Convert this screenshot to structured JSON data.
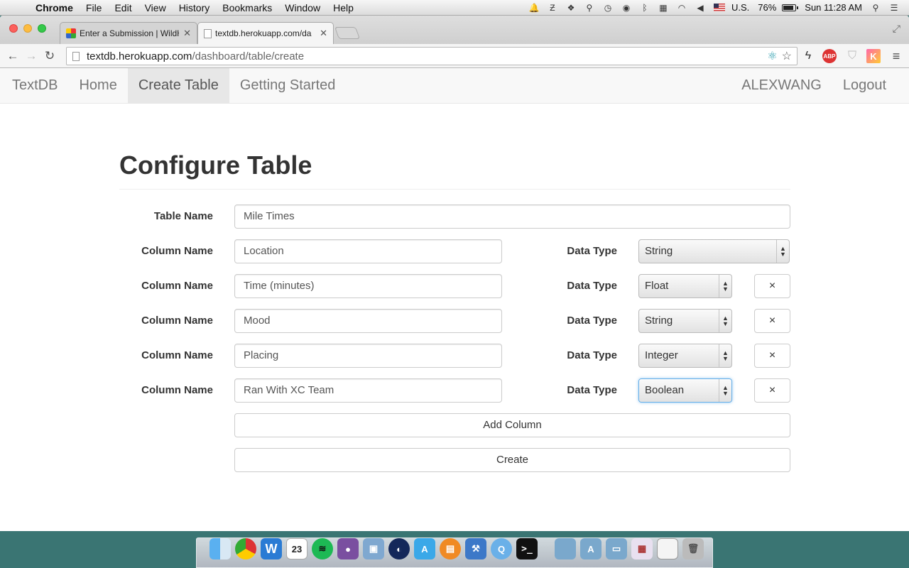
{
  "menubar": {
    "app_name": "Chrome",
    "menus": [
      "File",
      "Edit",
      "View",
      "History",
      "Bookmarks",
      "Window",
      "Help"
    ],
    "input_source": "U.S.",
    "battery": "76%",
    "clock": "Sun 11:28 AM"
  },
  "browser": {
    "tabs": [
      {
        "title": "Enter a Submission | WildH"
      },
      {
        "title": "textdb.herokuapp.com/da"
      }
    ],
    "url_host": "textdb.herokuapp.com",
    "url_path": "/dashboard/table/create",
    "extensions": {
      "abp": "ABP",
      "kred": "K"
    }
  },
  "navbar": {
    "brand": "TextDB",
    "links": [
      "Home",
      "Create Table",
      "Getting Started"
    ],
    "active": "Create Table",
    "user": "ALEXWANG",
    "logout": "Logout"
  },
  "form": {
    "heading": "Configure Table",
    "table_name_label": "Table Name",
    "table_name_value": "Mile Times",
    "column_label": "Column Name",
    "data_type_label": "Data Type",
    "columns": [
      {
        "name": "Location",
        "type": "String"
      },
      {
        "name": "Time (minutes)",
        "type": "Float"
      },
      {
        "name": "Mood",
        "type": "String"
      },
      {
        "name": "Placing",
        "type": "Integer"
      },
      {
        "name": "Ran With XC Team",
        "type": "Boolean"
      }
    ],
    "remove_label": "×",
    "add_column_label": "Add Column",
    "create_label": "Create"
  },
  "dock": {
    "calendar_day": "23"
  }
}
